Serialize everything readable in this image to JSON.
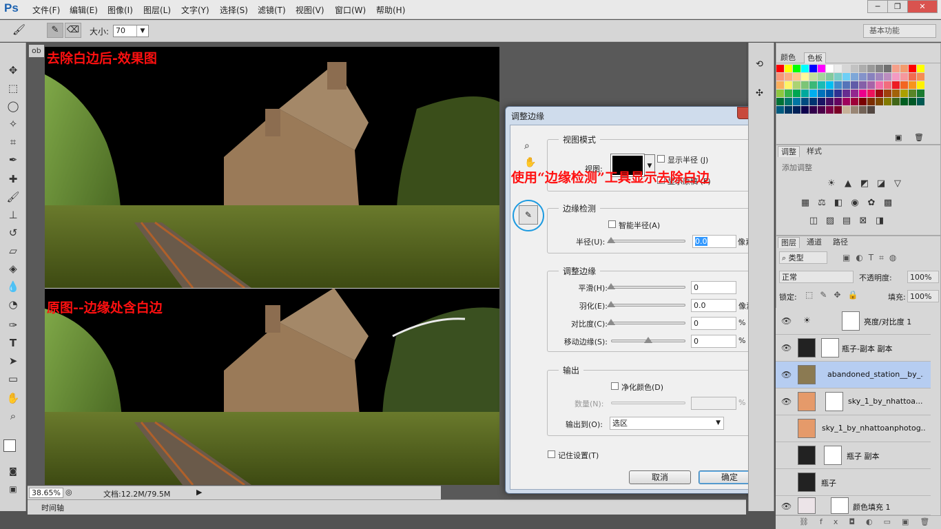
{
  "app": {
    "logo": "Ps"
  },
  "menu": [
    "文件(F)",
    "编辑(E)",
    "图像(I)",
    "图层(L)",
    "文字(Y)",
    "选择(S)",
    "滤镜(T)",
    "视图(V)",
    "窗口(W)",
    "帮助(H)"
  ],
  "window_controls": {
    "minimize": "─",
    "restore": "❐",
    "close": "✕"
  },
  "options": {
    "size_label": "大小:",
    "size_value": "70",
    "workspace": "基本功能"
  },
  "document": {
    "tab_label": "ob",
    "zoom": "38.65%",
    "doc_info": "文档:12.2M/79.5M",
    "timeline_label": "时间轴"
  },
  "captions": {
    "top": "去除白边后-效果图",
    "bottom": "原图--边缘处含白边",
    "dialog_annotation": "使用“边缘检测”工具显示去除白边"
  },
  "dialog": {
    "title": "调整边缘",
    "close": "✕",
    "view_mode": {
      "title": "视图模式",
      "view_label": "视图:",
      "show_radius": "显示半径 (J)",
      "show_original": "显示原稿 (P)"
    },
    "edge_detection": {
      "title": "边缘检测",
      "smart_radius": "智能半径(A)",
      "radius_label": "半径(U):",
      "radius_value": "0.0",
      "radius_unit": "像素"
    },
    "adjust_edge": {
      "title": "调整边缘",
      "rows": [
        {
          "label": "平滑(H):",
          "value": "0",
          "unit": "",
          "level": 0
        },
        {
          "label": "羽化(E):",
          "value": "0.0",
          "unit": "像素",
          "level": 0
        },
        {
          "label": "对比度(C):",
          "value": "0",
          "unit": "%",
          "level": 0
        },
        {
          "label": "移动边缘(S):",
          "value": "0",
          "unit": "%",
          "level": 0.5
        }
      ]
    },
    "output": {
      "title": "输出",
      "decontaminate": "净化颜色(D)",
      "amount_label": "数量(N):",
      "amount_unit": "%",
      "output_to_label": "输出到(O):",
      "output_to_value": "选区"
    },
    "remember": "记住设置(T)",
    "cancel": "取消",
    "ok": "确定"
  },
  "swatches_panel": {
    "tabs": [
      "颜色",
      "色板"
    ],
    "colors": [
      "#ff0000",
      "#ffff00",
      "#00ff00",
      "#00ffff",
      "#0000ff",
      "#ff00ff",
      "#ffffff",
      "#ebebeb",
      "#d6d6d6",
      "#c2c2c2",
      "#adadad",
      "#999999",
      "#858585",
      "#707070",
      "#f5a08a",
      "#f29b6d",
      "#ff0000",
      "#ffff00",
      "#f7977a",
      "#f9ad81",
      "#fdc68a",
      "#fff79a",
      "#c4df9b",
      "#a2d39c",
      "#82ca9d",
      "#7bcdc8",
      "#6ecff6",
      "#7ea7d8",
      "#8493ca",
      "#8882be",
      "#a187be",
      "#bc8dbf",
      "#f49ac2",
      "#f6989d",
      "#f26c4f",
      "#f68e55",
      "#fbaf5c",
      "#fff467",
      "#acd372",
      "#7cc576",
      "#3bb878",
      "#1abbb4",
      "#00bff3",
      "#438cca",
      "#5574b9",
      "#605ca8",
      "#855fa8",
      "#a763a8",
      "#f06ea9",
      "#f26d7d",
      "#ed1c24",
      "#f26522",
      "#f7941d",
      "#fff200",
      "#8dc73f",
      "#39b54a",
      "#00a651",
      "#00a99d",
      "#00aeef",
      "#0072bc",
      "#0054a6",
      "#2e3192",
      "#662d91",
      "#92278f",
      "#ec008c",
      "#ed145b",
      "#9e0b0f",
      "#a0410d",
      "#a36209",
      "#aba000",
      "#598527",
      "#1a7b30",
      "#007236",
      "#00746b",
      "#0076a3",
      "#004b80",
      "#003471",
      "#1b1464",
      "#440e62",
      "#630460",
      "#9e005d",
      "#9e0039",
      "#790000",
      "#7b2e00",
      "#7d4900",
      "#827b00",
      "#406618",
      "#005e20",
      "#005826",
      "#005952",
      "#005b7f",
      "#003663",
      "#002157",
      "#0d004c",
      "#32004b",
      "#4b0049",
      "#7b0046",
      "#7a0026",
      "#c7b299",
      "#998675",
      "#736357",
      "#534741"
    ]
  },
  "adjust_panel": {
    "tabs": [
      "调整",
      "样式"
    ],
    "hint": "添加调整"
  },
  "layers_panel": {
    "tabs": [
      "图层",
      "通道",
      "路径"
    ],
    "kind": "类型",
    "blend_mode": "正常",
    "opacity_label": "不透明度:",
    "opacity_value": "100%",
    "lock_label": "锁定:",
    "fill_label": "填充:",
    "fill_value": "100%",
    "layers": [
      {
        "name": "亮度/对比度 1",
        "visible": true
      },
      {
        "name": "瓶子-副本 副本",
        "visible": true
      },
      {
        "name": "abandoned_station__by_...",
        "visible": true
      },
      {
        "name": "sky_1_by_nhattoa...",
        "visible": true
      },
      {
        "name": "sky_1_by_nhattoanphotog...",
        "visible": false
      },
      {
        "name": "瓶子 副本",
        "visible": false
      },
      {
        "name": "瓶子",
        "visible": false
      },
      {
        "name": "颜色填充 1",
        "visible": true
      }
    ]
  }
}
